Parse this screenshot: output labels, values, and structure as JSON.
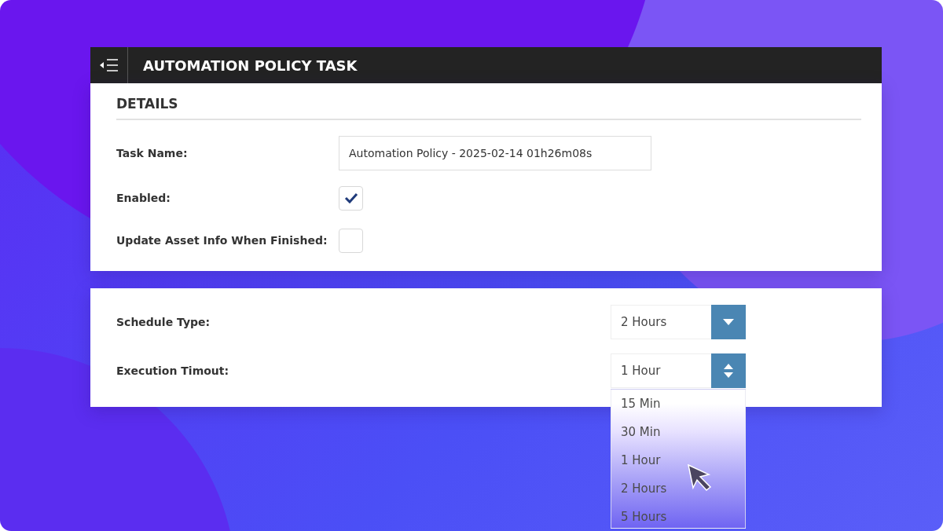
{
  "header": {
    "title": "AUTOMATION POLICY TASK"
  },
  "details": {
    "heading": "DETAILS",
    "fields": [
      {
        "kind": "text",
        "label": "Task Name:",
        "value": "Automation Policy - 2025-02-14 01h26m08s"
      },
      {
        "kind": "checkbox",
        "label": "Enabled:",
        "checked": true
      },
      {
        "kind": "checkbox",
        "label": "Update Asset Info When Finished:",
        "checked": false
      }
    ]
  },
  "schedule": {
    "fields": [
      {
        "kind": "select",
        "label": "Schedule Type:",
        "value": "2 Hours"
      },
      {
        "kind": "spinner",
        "label": "Execution Timout:",
        "value": "1 Hour",
        "expanded": true,
        "options": [
          "15 Min",
          "30 Min",
          "1 Hour",
          "2 Hours",
          "5 Hours"
        ]
      }
    ]
  }
}
